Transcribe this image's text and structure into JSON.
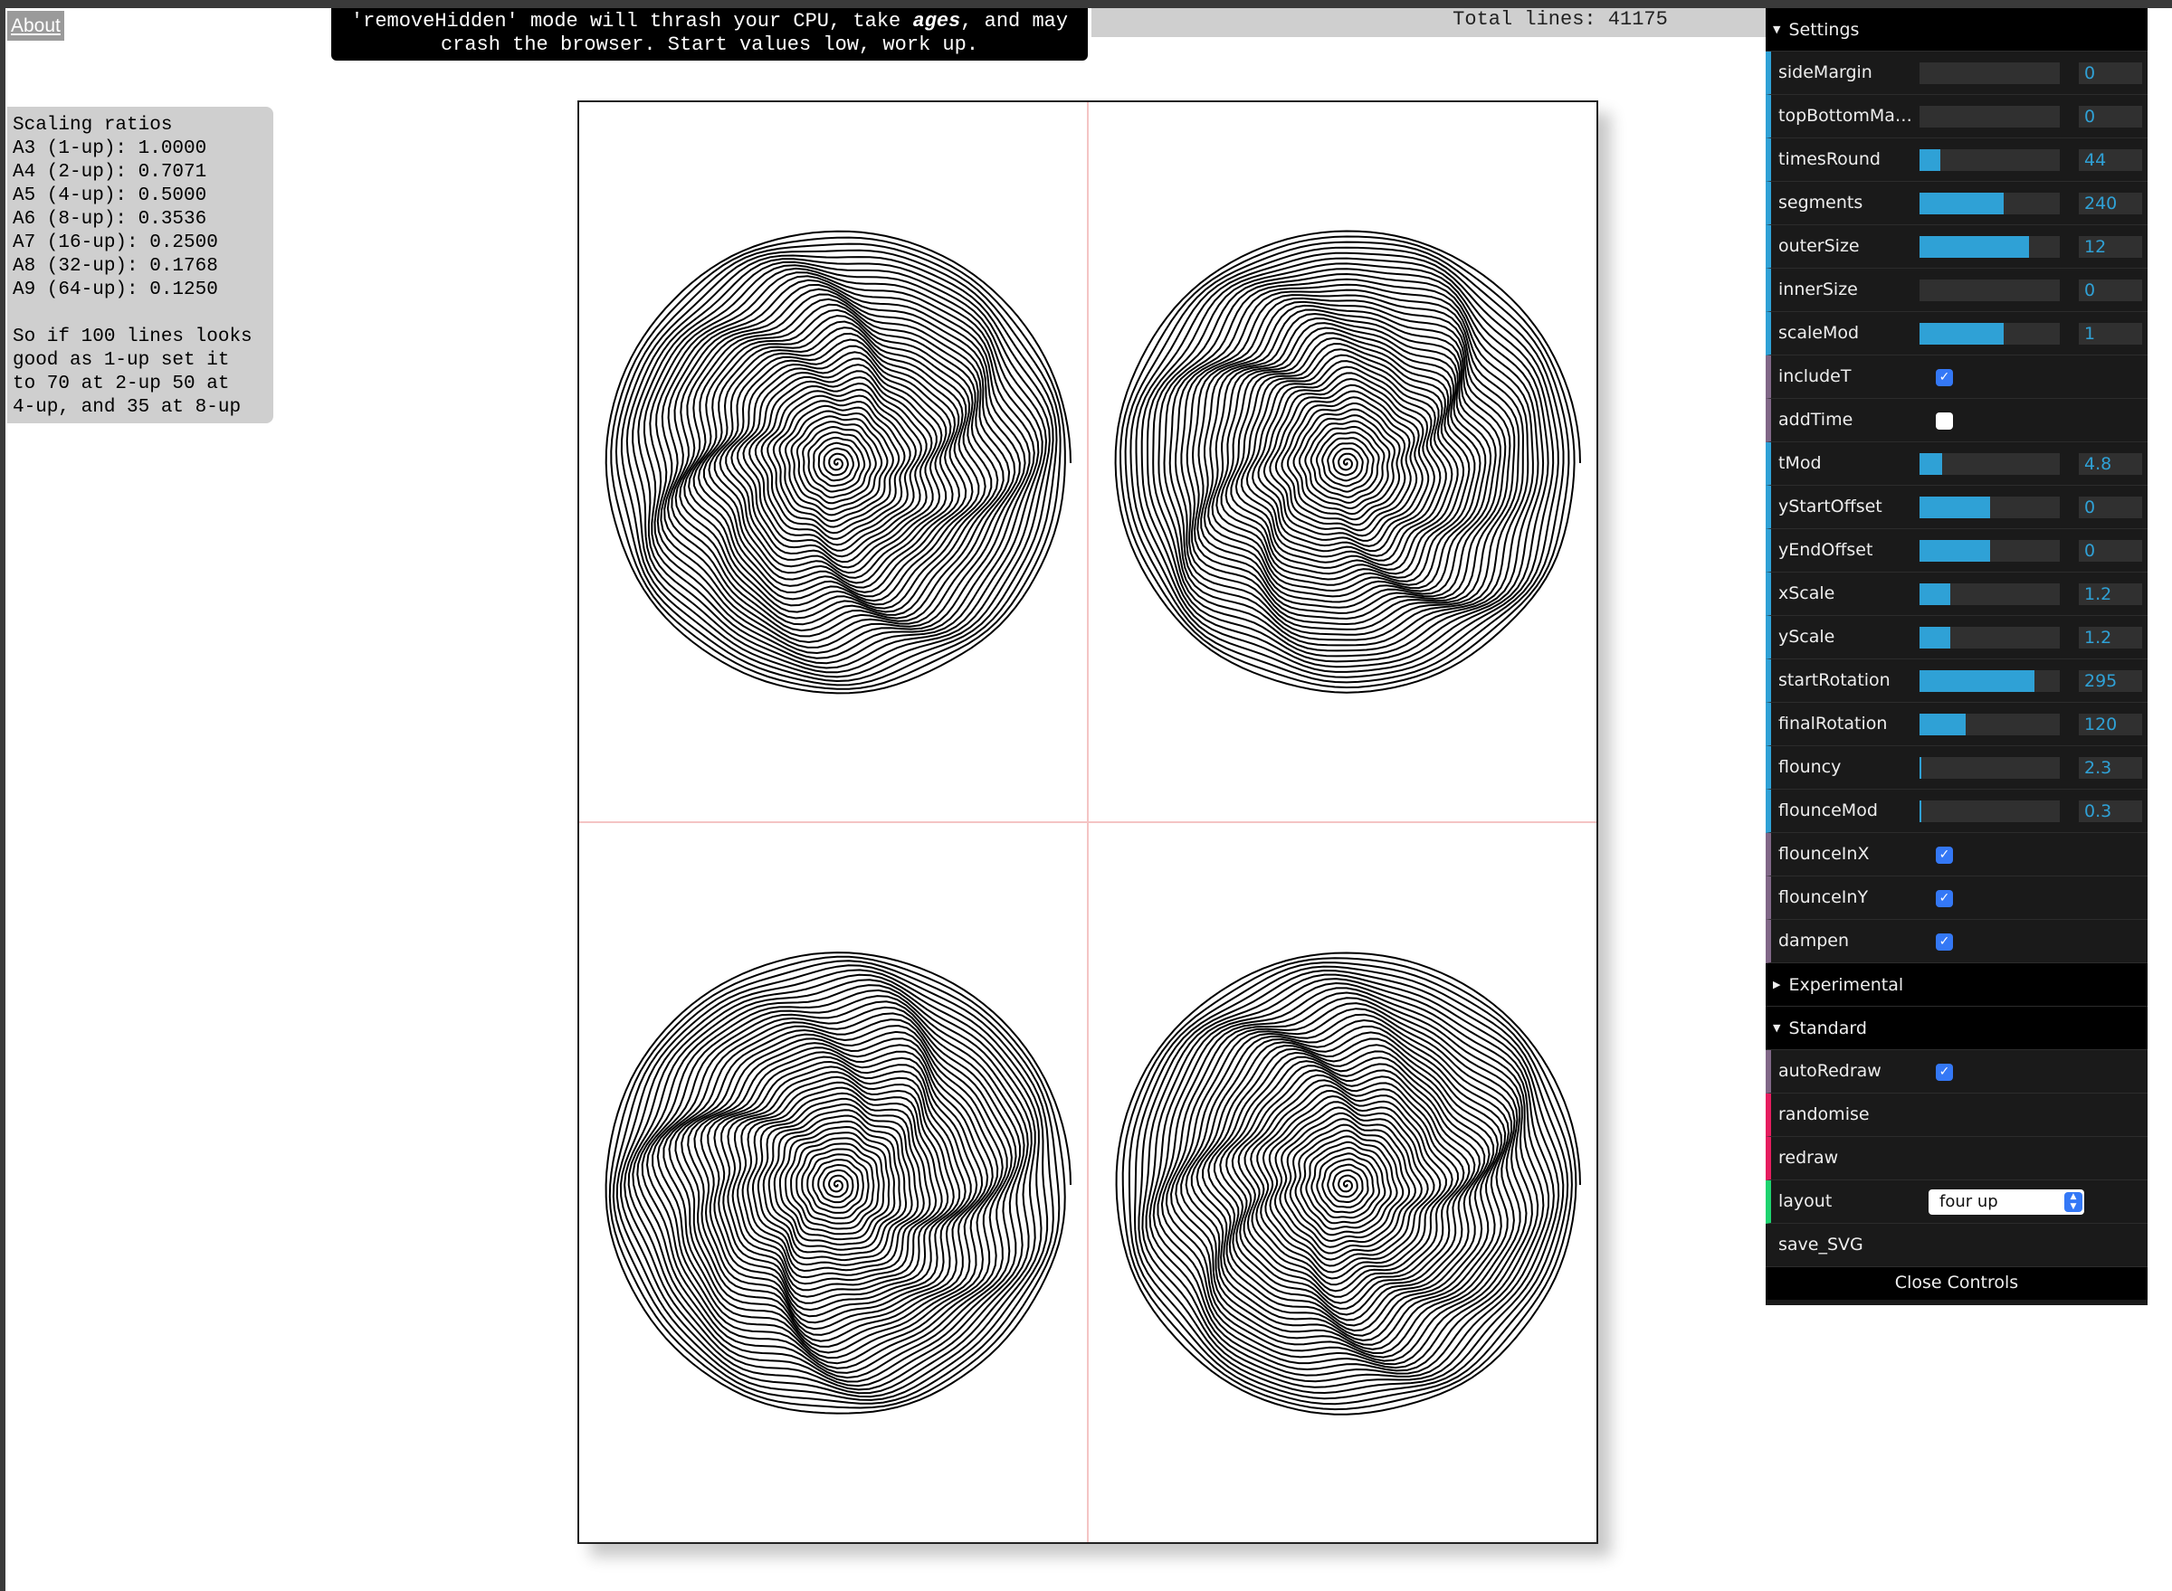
{
  "about_label": "About",
  "warning": {
    "line1_pre": "'removeHidden' mode will thrash your CPU, take ",
    "line1_em": "ages",
    "line1_post": ", and may",
    "line2": "crash the browser. Start values low, work up."
  },
  "total_lines": "Total lines: 41175",
  "scaling_ratios": {
    "title": "Scaling ratios",
    "lines": [
      "A3 (1-up): 1.0000",
      "A4 (2-up): 0.7071",
      "A5 (4-up): 0.5000",
      "A6 (8-up): 0.3536",
      "A7 (16-up): 0.2500",
      "A8 (32-up): 0.1768",
      "A9 (64-up): 0.1250"
    ],
    "note": [
      "So if 100 lines looks",
      "good as 1-up set it",
      "to 70 at 2-up 50 at",
      "4-up, and 35 at 8-up"
    ]
  },
  "colors": {
    "number_accent": "#2fa1d6",
    "function_accent": "#e61d5f",
    "bool_accent": "#806787",
    "select_accent": "#1ed36f",
    "checkbox_on": "#3478f6",
    "guide_line": "#f4c4c4"
  },
  "panel": {
    "settings_title": "Settings",
    "settings": [
      {
        "label": "sideMargin",
        "type": "slider",
        "value": "0",
        "fill": 0
      },
      {
        "label": "topBottomMar…",
        "type": "slider",
        "value": "0",
        "fill": 0
      },
      {
        "label": "timesRound",
        "type": "slider",
        "value": "44",
        "fill": 0.15
      },
      {
        "label": "segments",
        "type": "slider",
        "value": "240",
        "fill": 0.6
      },
      {
        "label": "outerSize",
        "type": "slider",
        "value": "12",
        "fill": 0.78
      },
      {
        "label": "innerSize",
        "type": "slider",
        "value": "0",
        "fill": 0
      },
      {
        "label": "scaleMod",
        "type": "slider",
        "value": "1",
        "fill": 0.6
      },
      {
        "label": "includeT",
        "type": "bool",
        "checked": true
      },
      {
        "label": "addTime",
        "type": "bool",
        "checked": false
      },
      {
        "label": "tMod",
        "type": "slider",
        "value": "4.8",
        "fill": 0.16
      },
      {
        "label": "yStartOffset",
        "type": "slider",
        "value": "0",
        "fill": 0.5
      },
      {
        "label": "yEndOffset",
        "type": "slider",
        "value": "0",
        "fill": 0.5
      },
      {
        "label": "xScale",
        "type": "slider",
        "value": "1.2",
        "fill": 0.22
      },
      {
        "label": "yScale",
        "type": "slider",
        "value": "1.2",
        "fill": 0.22
      },
      {
        "label": "startRotation",
        "type": "slider",
        "value": "295",
        "fill": 0.82
      },
      {
        "label": "finalRotation",
        "type": "slider",
        "value": "120",
        "fill": 0.33
      },
      {
        "label": "flouncy",
        "type": "slider",
        "value": "2.3",
        "fill": 0.01
      },
      {
        "label": "flounceMod",
        "type": "slider",
        "value": "0.3",
        "fill": 0.01
      },
      {
        "label": "flounceInX",
        "type": "bool",
        "checked": true
      },
      {
        "label": "flounceInY",
        "type": "bool",
        "checked": true
      },
      {
        "label": "dampen",
        "type": "bool",
        "checked": true
      }
    ],
    "experimental_title": "Experimental",
    "standard_title": "Standard",
    "standard": [
      {
        "label": "autoRedraw",
        "type": "bool",
        "checked": true
      },
      {
        "label": "randomise",
        "type": "fn"
      },
      {
        "label": "redraw",
        "type": "fn"
      },
      {
        "label": "layout",
        "type": "select",
        "value": "four up"
      }
    ],
    "save_label": "save_SVG",
    "close_label": "Close Controls"
  }
}
